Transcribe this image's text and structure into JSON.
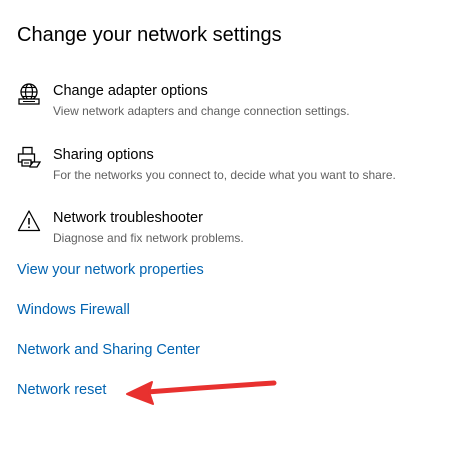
{
  "page": {
    "title": "Change your network settings"
  },
  "options": [
    {
      "title": "Change adapter options",
      "description": "View network adapters and change connection settings.",
      "icon": "globe-adapter-icon"
    },
    {
      "title": "Sharing options",
      "description": "For the networks you connect to, decide what you want to share.",
      "icon": "sharing-icon"
    },
    {
      "title": "Network troubleshooter",
      "description": "Diagnose and fix network problems.",
      "icon": "warning-triangle-icon"
    }
  ],
  "links": [
    {
      "label": "View your network properties"
    },
    {
      "label": "Windows Firewall"
    },
    {
      "label": "Network and Sharing Center"
    },
    {
      "label": "Network reset"
    }
  ],
  "annotation": {
    "arrow_color": "#e8312f",
    "points_to": "Network reset"
  },
  "colors": {
    "link": "#0063b1",
    "description": "#5f5f5f",
    "text": "#000000"
  }
}
